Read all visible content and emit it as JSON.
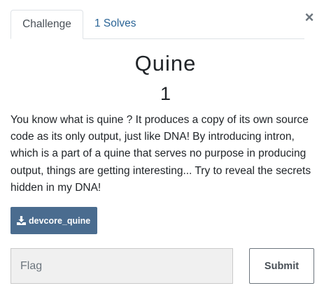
{
  "tabs": [
    {
      "label": "Challenge"
    },
    {
      "label": "1 Solves"
    }
  ],
  "close": {
    "glyph": "×"
  },
  "challenge": {
    "name": "Quine",
    "value": "1",
    "description": "You know what is quine ? It produces a copy of its own source code as its only output, just like DNA! By introducing intron, which is a part of a quine that serves no purpose in producing output, things are getting interesting... Try to reveal the secrets hidden in my DNA!",
    "file_label": "devcore_quine",
    "download_icon": "download-icon"
  },
  "form": {
    "flag_placeholder": "Flag",
    "submit_label": "Submit"
  },
  "colors": {
    "download_button": "#4a6c8f",
    "tab_link": "#2a6496",
    "input_background": "#f0f0f0"
  }
}
